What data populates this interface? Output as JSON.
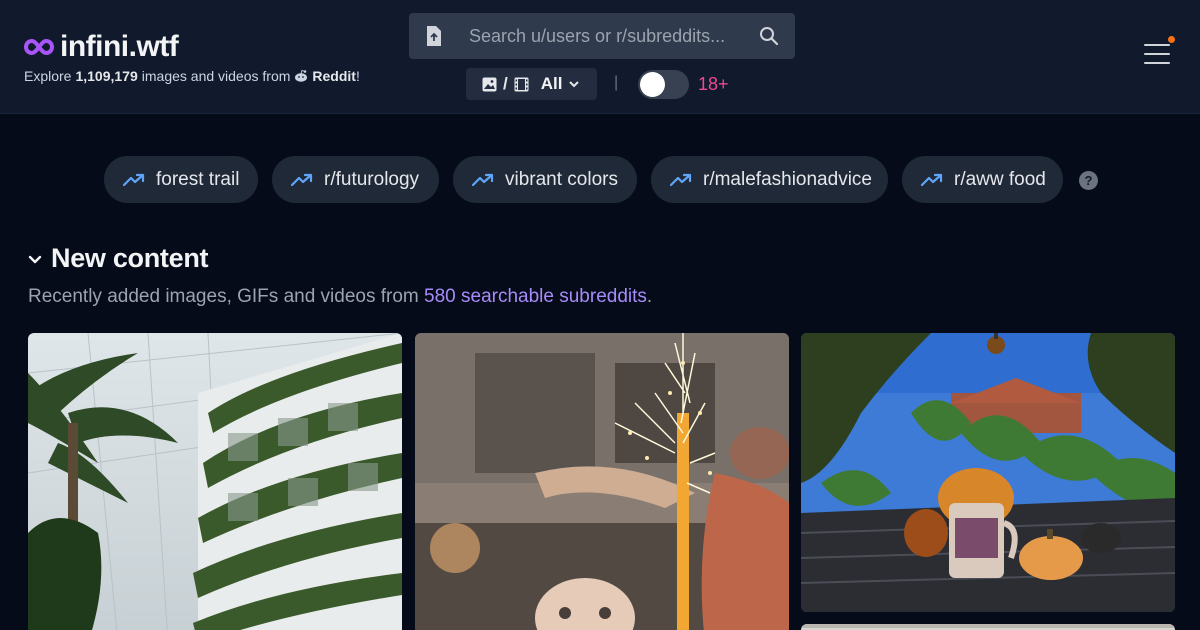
{
  "header": {
    "logo_text": "infini.wtf",
    "tagline_prefix": "Explore",
    "tagline_count": "1,109,179",
    "tagline_middle": "images and videos from",
    "tagline_source": "Reddit",
    "tagline_suffix": "!"
  },
  "search": {
    "placeholder": "Search u/users or r/subreddits..."
  },
  "filter": {
    "separator": "/",
    "value": "All"
  },
  "nsfw": {
    "label": "18+",
    "enabled": false,
    "divider": "|"
  },
  "trending": [
    {
      "label": "forest trail"
    },
    {
      "label": "r/futurology"
    },
    {
      "label": "vibrant colors"
    },
    {
      "label": "r/malefashionadvice"
    },
    {
      "label": "r/aww food"
    }
  ],
  "help": {
    "label": "?"
  },
  "section": {
    "title": "New content",
    "subtitle_prefix": "Recently added images, GIFs and videos from",
    "subtitle_link": "580 searchable subreddits",
    "subtitle_suffix": "."
  },
  "colors": {
    "accent": "#a78bfa",
    "logo_icon": "#a855f7",
    "nsfw": "#ec4899",
    "notification": "#f97316",
    "trend_icon": "#60a5fa"
  },
  "icons": {
    "logo": "infinity-icon",
    "upload": "file-upload-icon",
    "search": "search-icon",
    "image": "image-icon",
    "video": "film-icon",
    "dropdown": "chevron-down-icon",
    "menu": "hamburger-menu-icon",
    "trend": "trending-up-icon",
    "section": "chevron-down-icon"
  }
}
